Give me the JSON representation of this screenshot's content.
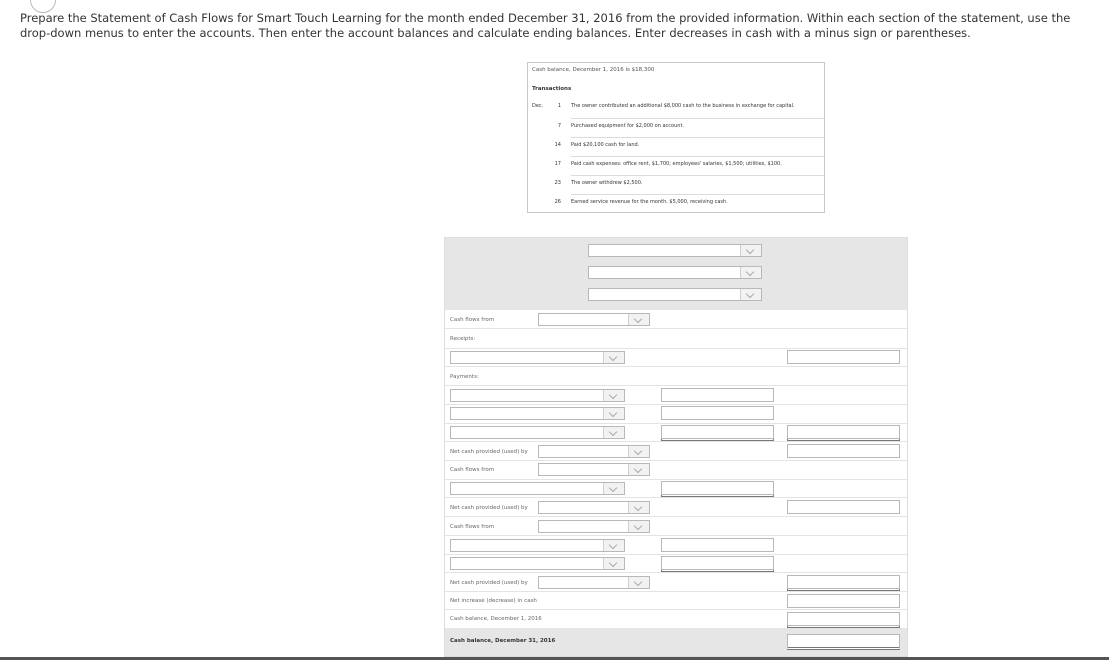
{
  "instructions": "Prepare the Statement of Cash Flows for Smart Touch Learning for the month ended December 31, 2016 from the provided information. Within each section of the statement, use the drop-down menus to enter the accounts. Then enter the account balances and calculate ending balances. Enter decreases in cash with a minus sign or parentheses.",
  "transactions_box": {
    "cash_balance_line": "Cash balance, December 1, 2016 is $18,300",
    "heading": "Transactions",
    "month": "Dec.",
    "items": [
      {
        "day": "1",
        "text": "The owner contributed an additional $8,000 cash to the business in exchange for capital."
      },
      {
        "day": "7",
        "text": "Purchased equipment for $2,000 on account."
      },
      {
        "day": "14",
        "text": "Paid $20,100 cash for land."
      },
      {
        "day": "17",
        "text": "Paid cash expenses: office rent, $1,700; employees' salaries, $1,500; utilities, $100."
      },
      {
        "day": "23",
        "text": "The owner withdrew $2,500."
      },
      {
        "day": "26",
        "text": "Earned service revenue for the month, $5,000, receiving cash."
      }
    ]
  },
  "statement": {
    "labels": {
      "cash_flows_from_1": "Cash flows from",
      "receipts": "Receipts:",
      "payments": "Payments:",
      "net_cash_1": "Net cash provided (used) by",
      "cash_flows_from_2": "Cash flows from",
      "net_cash_2": "Net cash provided (used) by",
      "cash_flows_from_3": "Cash flows from",
      "net_cash_3": "Net cash provided (used) by",
      "net_increase": "Net increase (decrease) in cash",
      "cash_balance_start": "Cash balance, December 1, 2016",
      "cash_balance_end": "Cash balance, December 31, 2016"
    }
  },
  "icons": {
    "dropdown": "chevron-down-icon"
  },
  "colors": {
    "header_gray": "#e6e6e6",
    "border": "#b8b8b8"
  }
}
